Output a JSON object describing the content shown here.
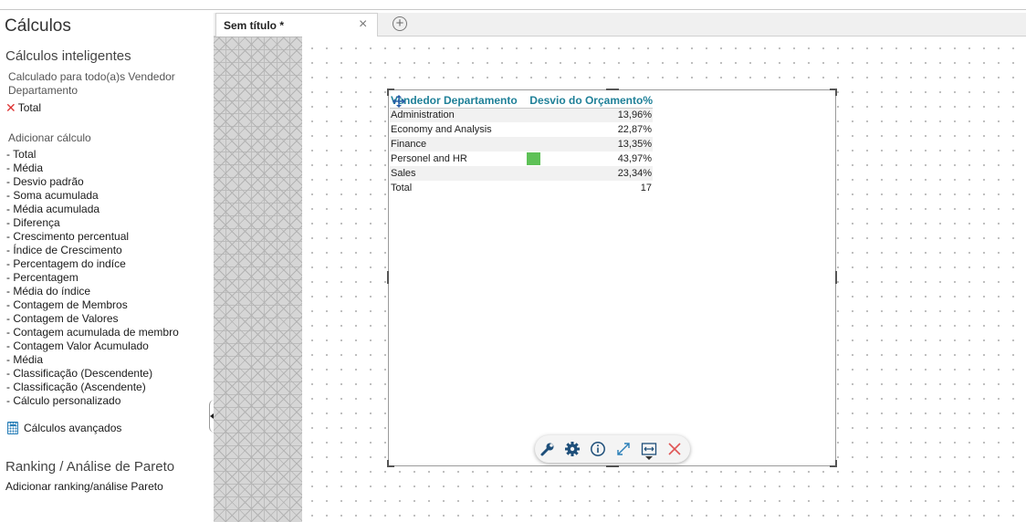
{
  "panel": {
    "title": "Cálculos",
    "smart_title": "Cálculos inteligentes",
    "calculated_for": "Calculado para todo(a)s Vendedor Departamento",
    "applied_total": "Total",
    "add_label": "Adicionar cálculo",
    "calc_items": [
      "- Total",
      "- Média",
      "- Desvio padrão",
      "- Soma acumulada",
      "- Média acumulada",
      "- Diferença",
      "- Crescimento percentual",
      "- Índice de Crescimento",
      "- Percentagem do indíce",
      "- Percentagem",
      "- Média do índice",
      "- Contagem de Membros",
      "- Contagem de Valores",
      "- Contagem acumulada de membro",
      "- Contagem Valor Acumulado",
      "- Média",
      "- Classificação (Descendente)",
      "- Classificação (Ascendente)",
      "- Cálculo personalizado"
    ],
    "advanced_label": "Cálculos avançados",
    "ranking_title": "Ranking / Análise de Pareto",
    "ranking_link": "Adicionar ranking/análise Pareto"
  },
  "tabs": {
    "active_label": "Sem título *",
    "close_glyph": "×",
    "add_glyph": "+"
  },
  "table": {
    "headers": [
      "Vendedor Departamento",
      "Desvio do Orçamento%"
    ],
    "rows": [
      {
        "name": "Administration",
        "value": "13,96%",
        "bar": 0
      },
      {
        "name": "Economy and Analysis",
        "value": "22,87%",
        "bar": 0
      },
      {
        "name": "Finance",
        "value": "13,35%",
        "bar": 0
      },
      {
        "name": "Personel and HR",
        "value": "43,97%",
        "bar": 1
      },
      {
        "name": "Sales",
        "value": "23,34%",
        "bar": 0
      },
      {
        "name": "Total",
        "value": "17",
        "bar": 0
      }
    ],
    "bar_color": "#5ec157",
    "header_color": "#1f8098"
  },
  "toolbar": {
    "icons": [
      "wrench-icon",
      "gear-icon",
      "info-icon",
      "expand-icon",
      "fit-width-icon",
      "close-icon"
    ]
  }
}
